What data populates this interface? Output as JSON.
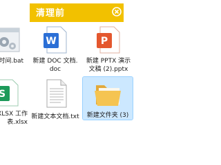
{
  "header": {
    "title": "清理前"
  },
  "files": [
    {
      "name": "时间.bat",
      "icon": "bat-gear-icon"
    },
    {
      "name": "新建 DOC 文档.\ndoc",
      "icon": "word-doc-icon",
      "letter": "W"
    },
    {
      "name": "新建 PPTX 演示\n文稿 (2).pptx",
      "icon": "powerpoint-icon",
      "letter": "P"
    },
    {
      "name": "X XLSX 工作\n表.xlsx",
      "icon": "excel-icon",
      "letter": "S"
    },
    {
      "name": "新建文本文档.txt",
      "icon": "text-file-icon"
    },
    {
      "name": "新建文件夹 (3)",
      "icon": "folder-icon"
    }
  ],
  "colors": {
    "banner": "#f2c100",
    "word": "#2b6fd6",
    "powerpoint": "#e4572e",
    "excel": "#1d9a5a",
    "folder": "#f5c451",
    "selection": "#cce8ff"
  }
}
